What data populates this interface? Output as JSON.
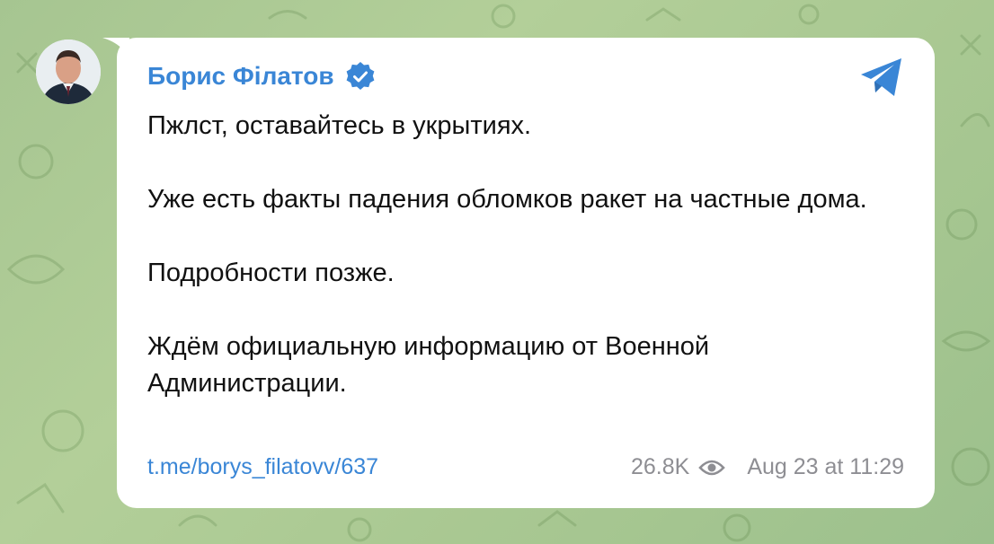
{
  "post": {
    "sender_name": "Борис Філатов",
    "verified_icon": "verified-badge-icon",
    "source_icon": "telegram-icon",
    "paragraphs": [
      "Пжлст, оставайтесь в укрытиях.",
      "Уже есть факты падения обломков ракет на частные дома.",
      "Подробности позже.",
      "Ждём официальную информацию от Военной Администрации."
    ],
    "link": "t.me/borys_filatovv/637",
    "views": "26.8K",
    "date": "Aug 23 at 11:29"
  },
  "colors": {
    "accent": "#3a86d6",
    "meta": "#8e8e93",
    "background": "#a9c892",
    "bubble": "#ffffff"
  }
}
